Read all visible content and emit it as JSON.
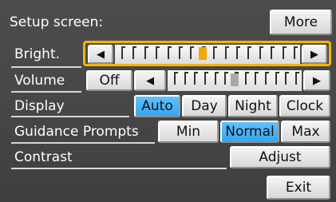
{
  "header": {
    "title": "Setup screen:",
    "more_label": "More"
  },
  "rows": {
    "bright": {
      "label": "Bright.",
      "level": 0.47,
      "left_arrow": "◀",
      "right_arrow": "▶"
    },
    "volume": {
      "label": "Volume",
      "off_label": "Off",
      "level": 0.5,
      "left_arrow": "◀",
      "right_arrow": "▶"
    },
    "display": {
      "label": "Display",
      "options": [
        "Auto",
        "Day",
        "Night",
        "Clock"
      ],
      "selected": "Auto"
    },
    "guidance": {
      "label": "Guidance Prompts",
      "options": [
        "Min",
        "Normal",
        "Max"
      ],
      "selected": "Normal"
    },
    "contrast": {
      "label": "Contrast",
      "adjust_label": "Adjust"
    }
  },
  "footer": {
    "exit_label": "Exit"
  },
  "colors": {
    "accent_selected": "#3bb0f5",
    "focus_frame": "#f6b400",
    "background": "#464646"
  }
}
